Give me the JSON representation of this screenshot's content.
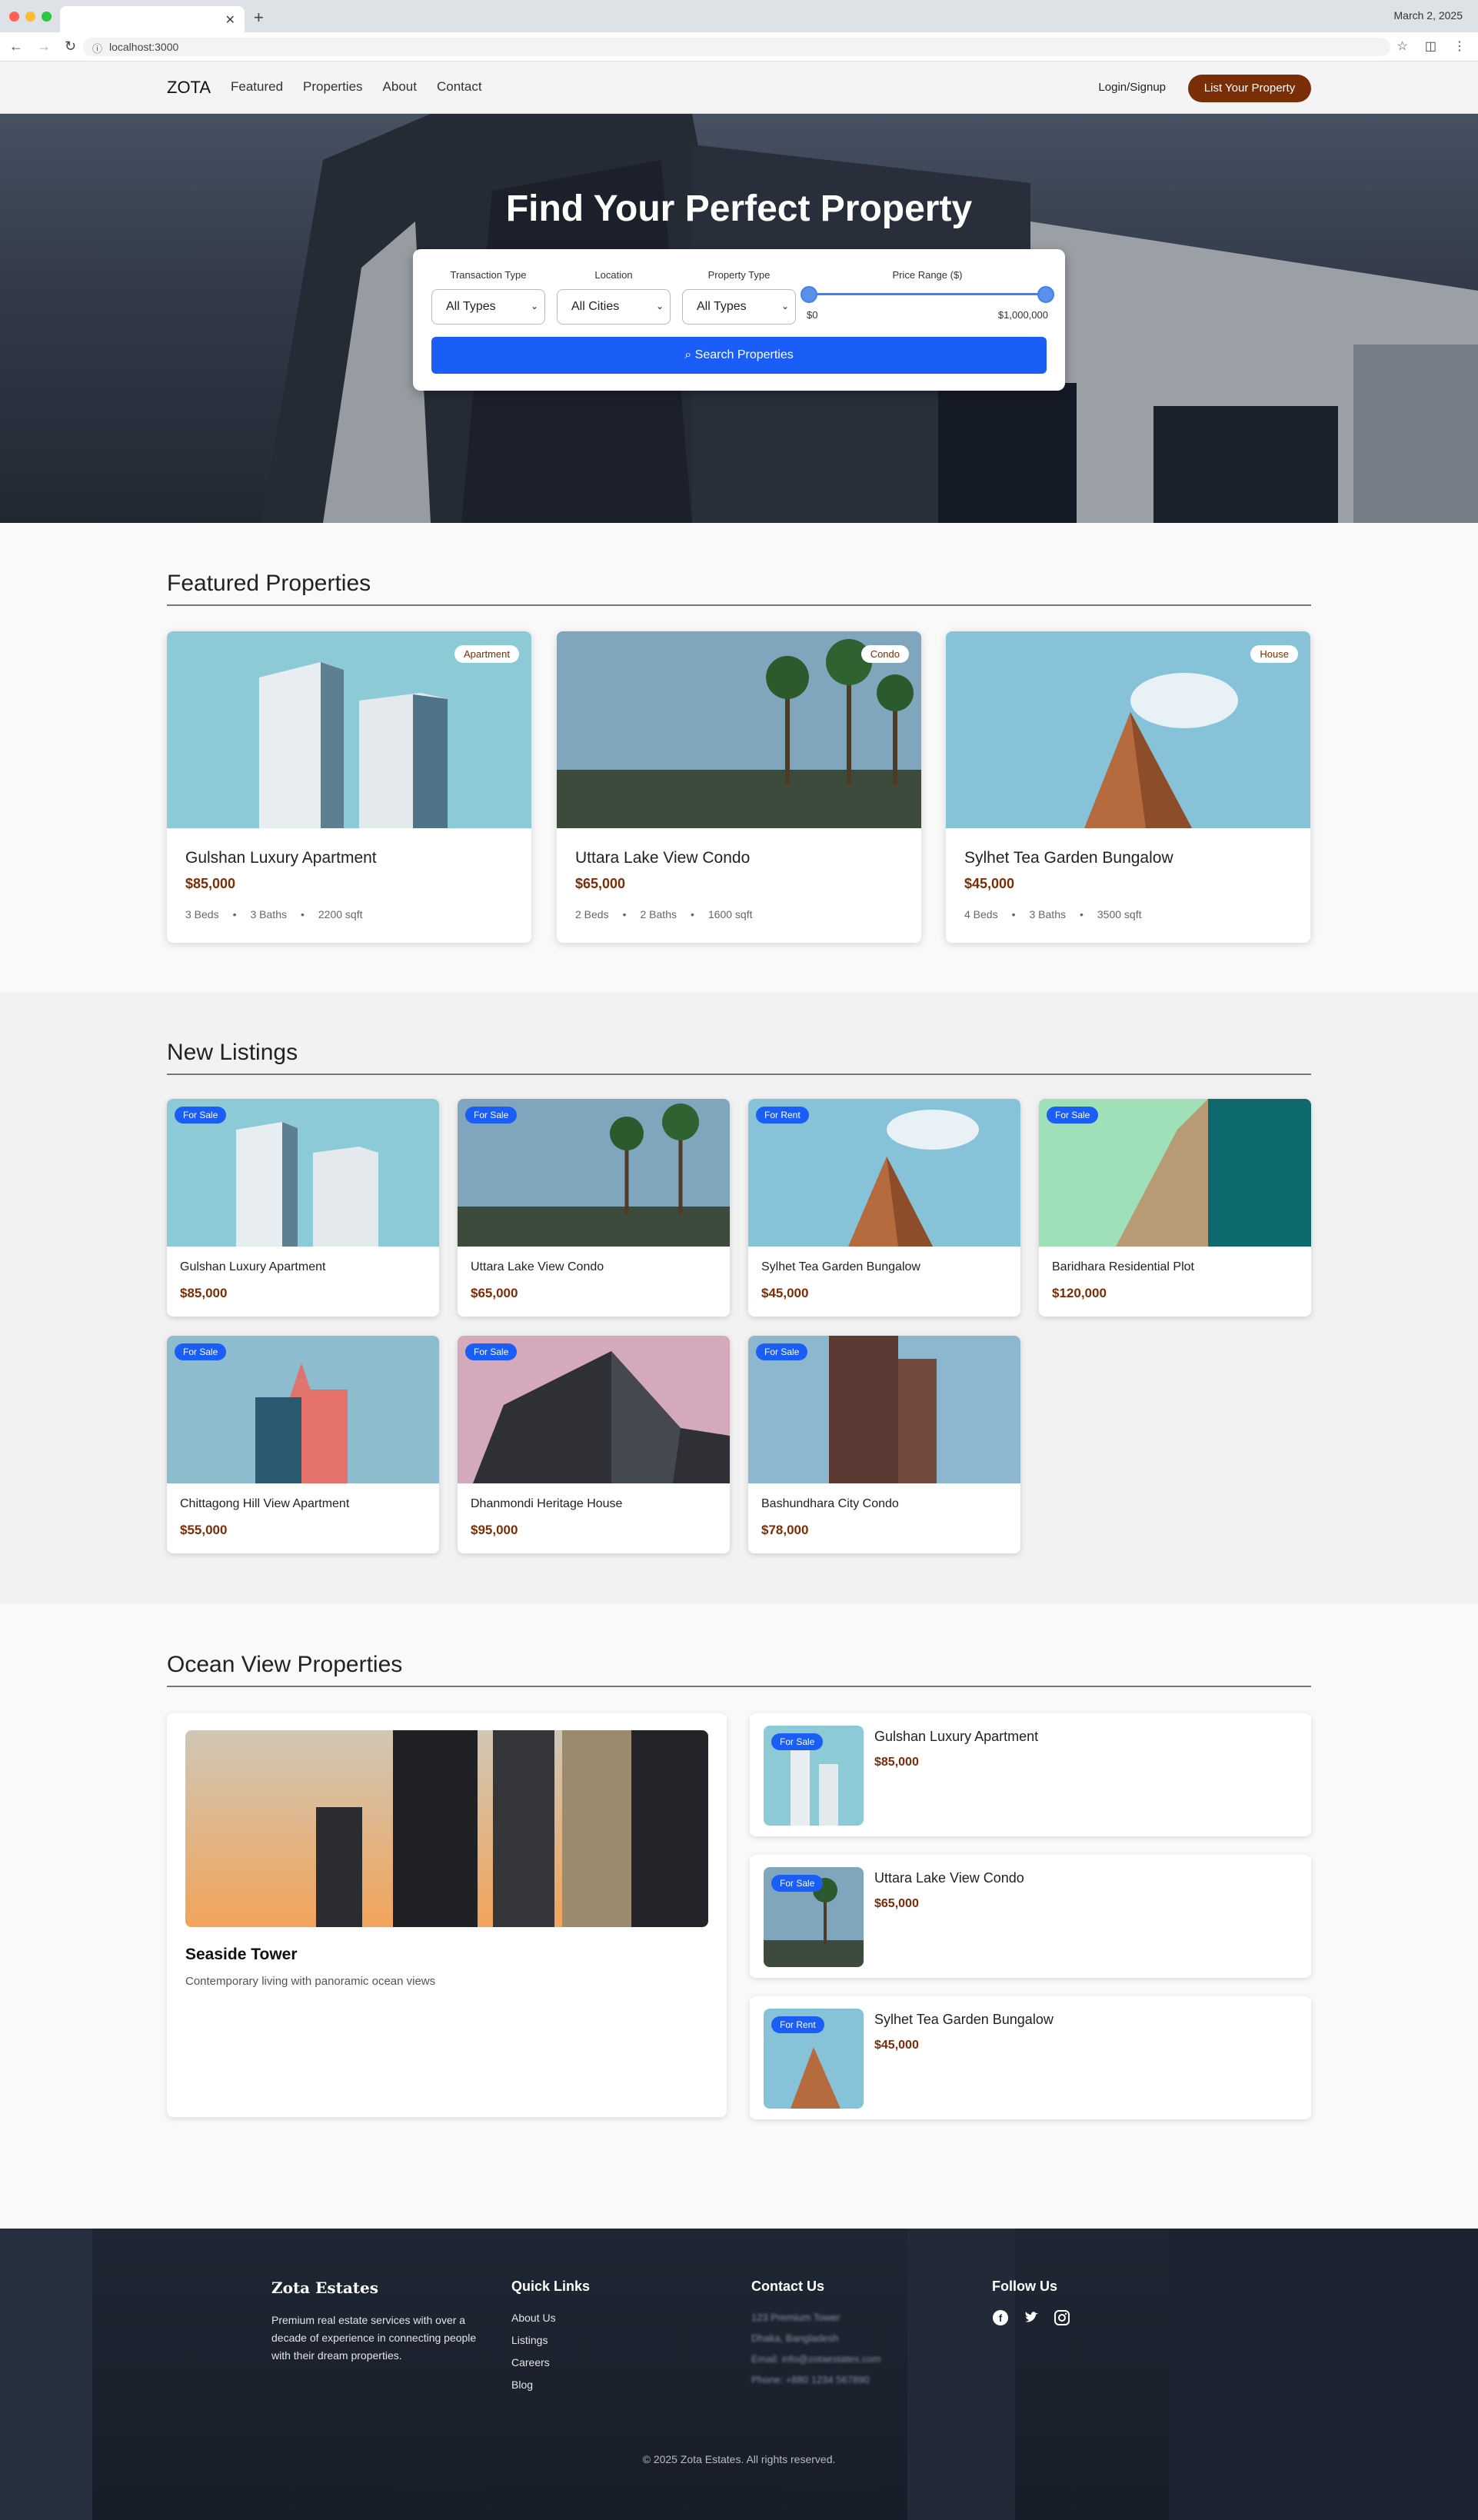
{
  "browser": {
    "date": "March 2, 2025",
    "url": "localhost:3000"
  },
  "nav": {
    "logo": "ZOTA",
    "links": [
      "Featured",
      "Properties",
      "About",
      "Contact"
    ],
    "login": "Login/Signup",
    "cta": "List Your Property"
  },
  "hero": {
    "title": "Find Your Perfect Property",
    "search": {
      "transaction_label": "Transaction Type",
      "transaction_value": "All Types",
      "location_label": "Location",
      "location_value": "All Cities",
      "property_label": "Property Type",
      "property_value": "All Types",
      "price_label": "Price Range ($)",
      "price_min": "$0",
      "price_max": "$1,000,000",
      "button": "Search Properties"
    }
  },
  "featured": {
    "title": "Featured Properties",
    "cards": [
      {
        "name": "Gulshan Luxury Apartment",
        "price": "$85,000",
        "tag": "Apartment",
        "beds": "3 Beds",
        "baths": "3 Baths",
        "area": "2200 sqft"
      },
      {
        "name": "Uttara Lake View Condo",
        "price": "$65,000",
        "tag": "Condo",
        "beds": "2 Beds",
        "baths": "2 Baths",
        "area": "1600 sqft"
      },
      {
        "name": "Sylhet Tea Garden Bungalow",
        "price": "$45,000",
        "tag": "House",
        "beds": "4 Beds",
        "baths": "3 Baths",
        "area": "3500 sqft"
      }
    ]
  },
  "listings": {
    "title": "New Listings",
    "cards": [
      {
        "name": "Gulshan Luxury Apartment",
        "price": "$85,000",
        "badge": "For Sale"
      },
      {
        "name": "Uttara Lake View Condo",
        "price": "$65,000",
        "badge": "For Sale"
      },
      {
        "name": "Sylhet Tea Garden Bungalow",
        "price": "$45,000",
        "badge": "For Rent"
      },
      {
        "name": "Baridhara Residential Plot",
        "price": "$120,000",
        "badge": "For Sale"
      },
      {
        "name": "Chittagong Hill View Apartment",
        "price": "$55,000",
        "badge": "For Sale"
      },
      {
        "name": "Dhanmondi Heritage House",
        "price": "$95,000",
        "badge": "For Sale"
      },
      {
        "name": "Bashundhara City Condo",
        "price": "$78,000",
        "badge": "For Sale"
      }
    ]
  },
  "ocean": {
    "title": "Ocean View Properties",
    "main": {
      "name": "Seaside Tower",
      "desc": "Contemporary living with panoramic ocean views"
    },
    "side": [
      {
        "name": "Gulshan Luxury Apartment",
        "price": "$85,000",
        "badge": "For Sale"
      },
      {
        "name": "Uttara Lake View Condo",
        "price": "$65,000",
        "badge": "For Sale"
      },
      {
        "name": "Sylhet Tea Garden Bungalow",
        "price": "$45,000",
        "badge": "For Rent"
      }
    ]
  },
  "footer": {
    "brand": "Zota Estates",
    "about": "Premium real estate services with over a decade of experience in connecting people with their dream properties.",
    "quick_title": "Quick Links",
    "quick_links": [
      "About Us",
      "Listings",
      "Careers",
      "Blog"
    ],
    "contact_title": "Contact Us",
    "contact": [
      "123 Premium Tower",
      "Dhaka, Bangladesh",
      "Email: info@zotaestates.com",
      "Phone: +880 1234 567890"
    ],
    "follow_title": "Follow Us",
    "social_icons": [
      "facebook-icon",
      "twitter-icon",
      "instagram-icon"
    ],
    "copyright": "© 2025 Zota Estates. All rights reserved."
  },
  "colors": {
    "brand": "#7a2e07",
    "accent": "#1a5ef7"
  }
}
